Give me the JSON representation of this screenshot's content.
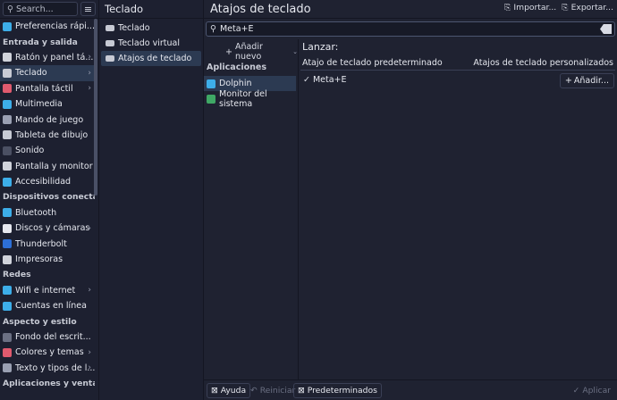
{
  "sidebar": {
    "search_placeholder": "Search...",
    "sections": [
      {
        "type": "item",
        "label": "Preferencias rápi...",
        "icon": "quick-settings-icon",
        "color": "#3daee9"
      },
      {
        "type": "head",
        "label": "Entrada y salida"
      },
      {
        "type": "item",
        "label": "Ratón y panel tá...",
        "icon": "mouse-icon",
        "color": "#d0d3db",
        "arrow": true
      },
      {
        "type": "item",
        "label": "Teclado",
        "icon": "keyboard-icon",
        "color": "#c7cad4",
        "arrow": true,
        "selected": true
      },
      {
        "type": "item",
        "label": "Pantalla táctil",
        "icon": "touchscreen-icon",
        "color": "#e05a6e",
        "arrow": true
      },
      {
        "type": "item",
        "label": "Multimedia",
        "icon": "multimedia-icon",
        "color": "#3daee9"
      },
      {
        "type": "item",
        "label": "Mando de juego",
        "icon": "gamepad-icon",
        "color": "#9aa0b2"
      },
      {
        "type": "item",
        "label": "Tableta de dibujo",
        "icon": "tablet-icon",
        "color": "#c7cad4"
      },
      {
        "type": "item",
        "label": "Sonido",
        "icon": "sound-icon",
        "color": "#4b5063"
      },
      {
        "type": "item",
        "label": "Pantalla y monitor",
        "icon": "monitor-icon",
        "color": "#d0d3db"
      },
      {
        "type": "item",
        "label": "Accesibilidad",
        "icon": "accessibility-icon",
        "color": "#3daee9"
      },
      {
        "type": "head",
        "label": "Dispositivos conecta..."
      },
      {
        "type": "item",
        "label": "Bluetooth",
        "icon": "bluetooth-icon",
        "color": "#3daee9"
      },
      {
        "type": "item",
        "label": "Discos y cámaras",
        "icon": "disk-icon",
        "color": "#e6e8ef",
        "arrow": true
      },
      {
        "type": "item",
        "label": "Thunderbolt",
        "icon": "thunderbolt-icon",
        "color": "#2d6fd6"
      },
      {
        "type": "item",
        "label": "Impresoras",
        "icon": "printer-icon",
        "color": "#d0d3db"
      },
      {
        "type": "head",
        "label": "Redes"
      },
      {
        "type": "item",
        "label": "Wifi e internet",
        "icon": "wifi-icon",
        "color": "#3daee9",
        "arrow": true
      },
      {
        "type": "item",
        "label": "Cuentas en línea",
        "icon": "accounts-icon",
        "color": "#3daee9"
      },
      {
        "type": "head",
        "label": "Aspecto y estilo"
      },
      {
        "type": "item",
        "label": "Fondo del escrit...",
        "icon": "wallpaper-icon",
        "color": "#6b7083"
      },
      {
        "type": "item",
        "label": "Colores y temas",
        "icon": "colors-icon",
        "color": "#e05a6e",
        "arrow": true
      },
      {
        "type": "item",
        "label": "Texto y tipos de l...",
        "icon": "fonts-icon",
        "color": "#9aa0b2",
        "arrow": true
      },
      {
        "type": "head",
        "label": "Aplicaciones y venta..."
      }
    ]
  },
  "subpanel": {
    "title": "Teclado",
    "items": [
      {
        "label": "Teclado",
        "icon": "keyboard-icon",
        "selected": false
      },
      {
        "label": "Teclado virtual",
        "icon": "virtual-keyboard-icon",
        "selected": false
      },
      {
        "label": "Atajos de teclado",
        "icon": "shortcuts-icon",
        "selected": true
      }
    ]
  },
  "main": {
    "title": "Atajos de teclado",
    "import_label": "Importar...",
    "export_label": "Exportar...",
    "filter_value": "Meta+E",
    "add_new_label": "Añadir nuevo",
    "list_heading": "Aplicaciones",
    "apps": [
      {
        "label": "Dolphin",
        "icon": "folder-icon",
        "color": "#3daee9",
        "selected": true
      },
      {
        "label": "Monitor del sistema",
        "icon": "system-monitor-icon",
        "color": "#3fa865",
        "selected": false
      }
    ],
    "launch_label": "Lanzar:",
    "col_default": "Atajo de teclado predeterminado",
    "col_custom": "Atajos de teclado personalizados",
    "default_shortcut": "Meta+E",
    "add_shortcut_label": "Añadir..."
  },
  "footer": {
    "help": "Ayuda",
    "reset": "Reiniciar",
    "defaults": "Predeterminados",
    "apply": "Aplicar"
  }
}
